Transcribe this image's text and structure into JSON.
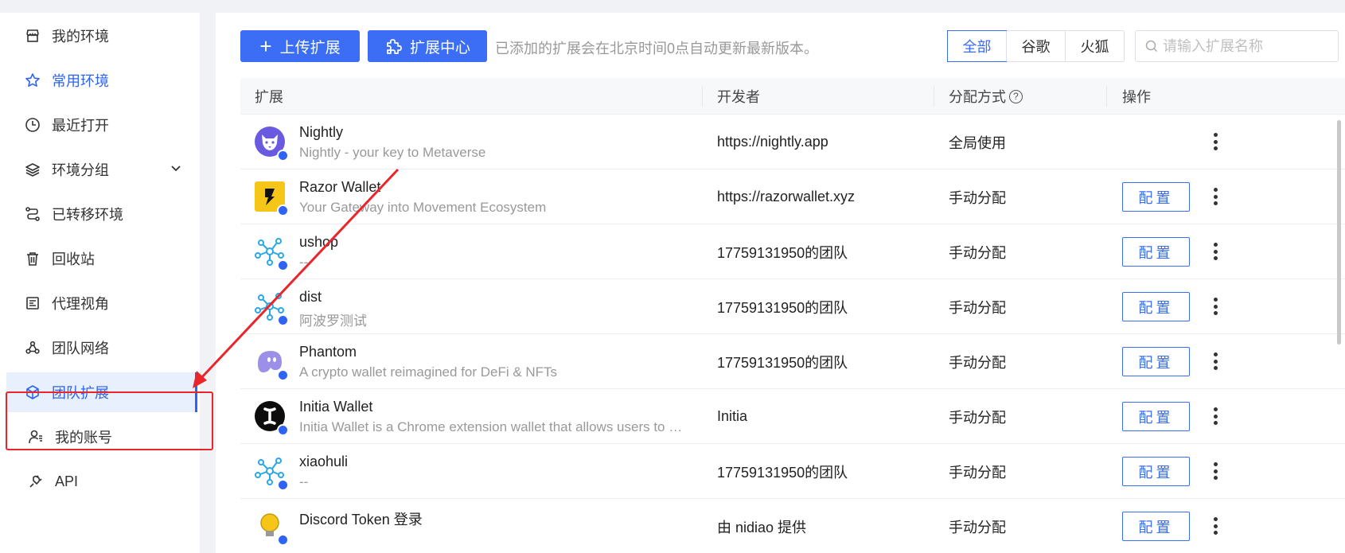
{
  "sidebar": {
    "items": [
      {
        "label": "我的环境",
        "icon": "store-icon"
      },
      {
        "label": "常用环境",
        "icon": "star-icon"
      },
      {
        "label": "最近打开",
        "icon": "clock-icon"
      },
      {
        "label": "环境分组",
        "icon": "layers-icon"
      },
      {
        "label": "已转移环境",
        "icon": "transfer-icon"
      },
      {
        "label": "回收站",
        "icon": "trash-icon"
      },
      {
        "label": "代理视角",
        "icon": "proxy-icon"
      },
      {
        "label": "团队网络",
        "icon": "network-icon"
      },
      {
        "label": "团队扩展",
        "icon": "cube-icon"
      },
      {
        "label": "我的账号",
        "icon": "user-icon"
      },
      {
        "label": "API",
        "icon": "plug-icon"
      }
    ]
  },
  "toolbar": {
    "upload_label": "上传扩展",
    "center_label": "扩展中心",
    "note": "已添加的扩展会在北京时间0点自动更新最新版本。",
    "filters": [
      "全部",
      "谷歌",
      "火狐"
    ],
    "search_placeholder": "请输入扩展名称"
  },
  "table": {
    "headers": [
      "扩展",
      "开发者",
      "分配方式",
      "操作"
    ],
    "config_label": "配置",
    "rows": [
      {
        "name": "Nightly",
        "desc": "Nightly - your key to Metaverse",
        "developer": "https://nightly.app",
        "distribution": "全局使用",
        "icon": "fox-logo-icon",
        "has_config": false
      },
      {
        "name": "Razor Wallet",
        "desc": "Your Gateway into Movement Ecosystem",
        "developer": "https://razorwallet.xyz",
        "distribution": "手动分配",
        "icon": "razor-logo-icon",
        "has_config": true
      },
      {
        "name": "ushop",
        "desc": "--",
        "developer": "17759131950的团队",
        "distribution": "手动分配",
        "icon": "molecule-icon",
        "has_config": true
      },
      {
        "name": "dist",
        "desc": "阿波罗测试",
        "developer": "17759131950的团队",
        "distribution": "手动分配",
        "icon": "molecule-icon",
        "has_config": true
      },
      {
        "name": "Phantom",
        "desc": "A crypto wallet reimagined for DeFi & NFTs",
        "developer": "17759131950的团队",
        "distribution": "手动分配",
        "icon": "ghost-logo-icon",
        "has_config": true
      },
      {
        "name": "Initia Wallet",
        "desc": "Initia Wallet is a Chrome extension wallet that allows users to acce...",
        "developer": "Initia",
        "distribution": "手动分配",
        "icon": "initia-logo-icon",
        "has_config": true
      },
      {
        "name": "xiaohuli",
        "desc": "--",
        "developer": "17759131950的团队",
        "distribution": "手动分配",
        "icon": "molecule-icon",
        "has_config": true
      },
      {
        "name": "Discord Token 登录",
        "desc": "",
        "developer": "由 nidiao 提供",
        "distribution": "手动分配",
        "icon": "bulb-icon",
        "has_config": true
      }
    ]
  },
  "colors": {
    "accent": "#3b6ef5",
    "selected_bg": "#e8f0fd",
    "annotation_red": "#e8262b"
  }
}
